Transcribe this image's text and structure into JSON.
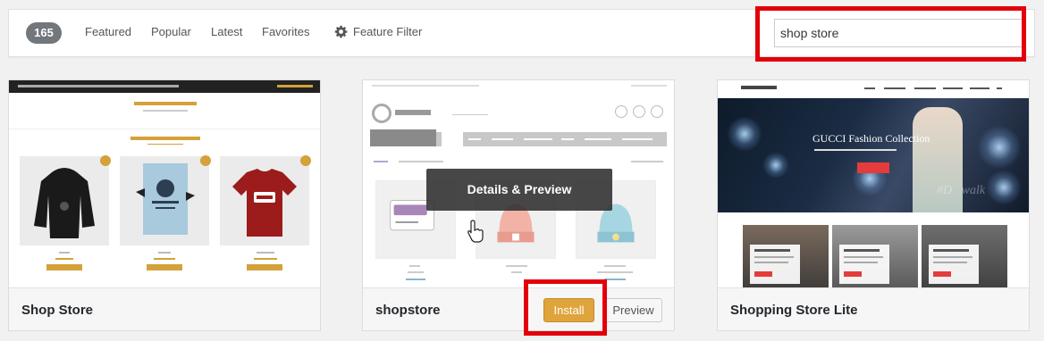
{
  "filter_bar": {
    "count": "165",
    "links": [
      {
        "label": "Featured"
      },
      {
        "label": "Popular"
      },
      {
        "label": "Latest"
      },
      {
        "label": "Favorites"
      }
    ],
    "feature_filter_label": "Feature Filter",
    "search_value": "shop store"
  },
  "themes": [
    {
      "name": "Shop Store"
    },
    {
      "name": "shopstore",
      "overlay_label": "Details & Preview",
      "install_label": "Install",
      "preview_label": "Preview"
    },
    {
      "name": "Shopping Store Lite",
      "hero_title": "GUCCI Fashion Collection"
    }
  ],
  "colors": {
    "accent_install": "#e0a43c",
    "highlight_red": "#e3000b",
    "count_badge": "#72777c"
  }
}
